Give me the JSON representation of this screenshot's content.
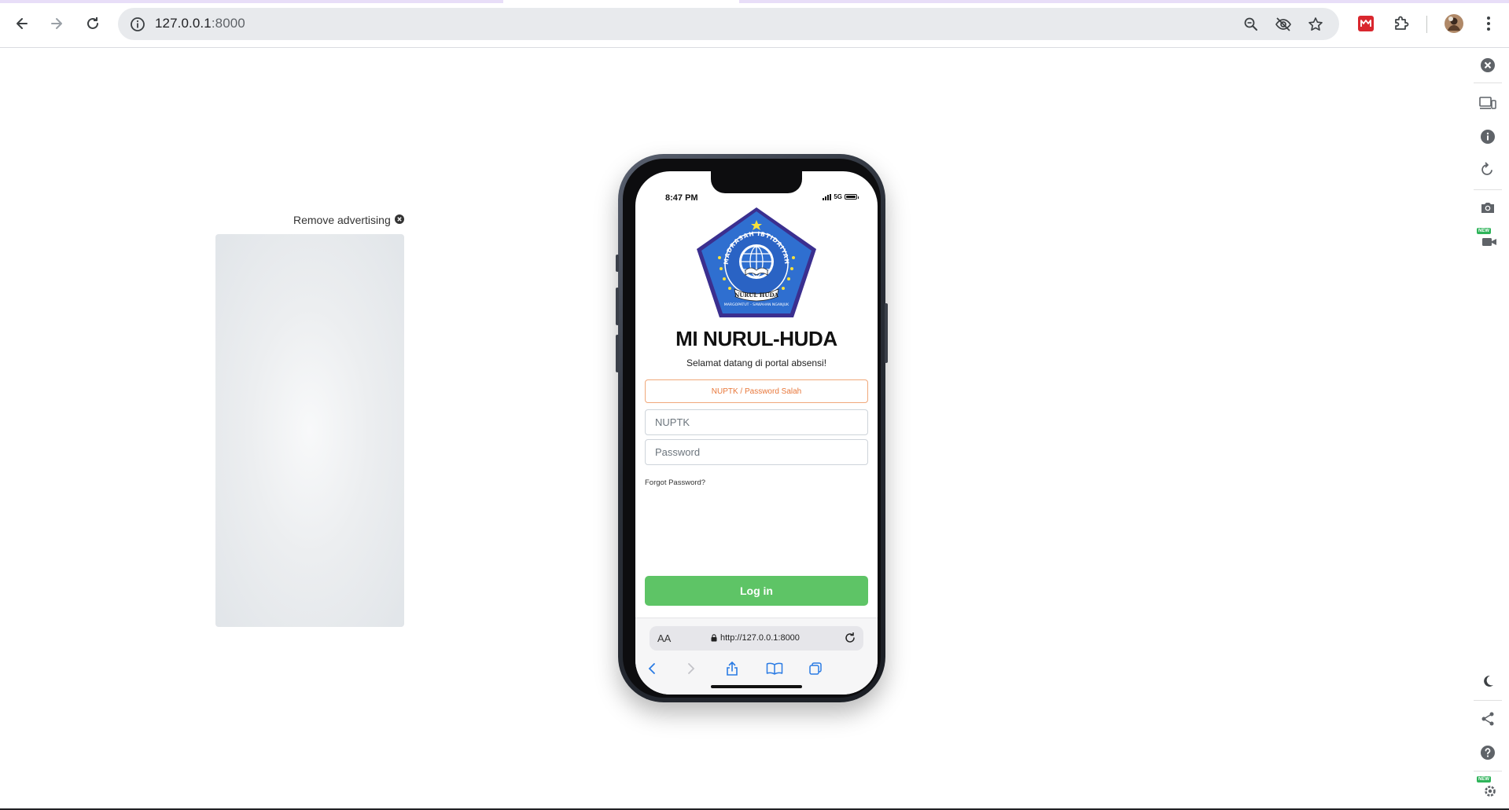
{
  "browser": {
    "url_host": "127.0.0.1",
    "url_port": ":8000",
    "icons": [
      "back-arrow-icon",
      "forward-arrow-icon",
      "reload-icon",
      "site-info-icon",
      "zoom-icon",
      "eye-off-icon",
      "star-icon",
      "extension-red-icon",
      "puzzle-icon",
      "profile-avatar",
      "kebab-menu-icon"
    ]
  },
  "ad": {
    "remove_label": "Remove advertising"
  },
  "phone": {
    "status_time": "8:47 PM",
    "network": "5G",
    "school_name": "MI NURUL-HUDA",
    "welcome": "Selamat datang di portal absensi!",
    "error_message": "NUPTK / Password Salah",
    "nuptk_placeholder": "NUPTK",
    "password_placeholder": "Password",
    "forgot_password": "Forgot Password?",
    "login_label": "Log in",
    "safari_aa": "AA",
    "safari_url": "http://127.0.0.1:8000",
    "logo_text_top": "MADRASAH IBTIDAIYAH",
    "logo_ribbon": "NURUL HUDA",
    "logo_text_bottom": "MARGOPATUT - SAWAHAN NGANJUK"
  },
  "sidebar_panel": {
    "icons": [
      "close-icon",
      "devices-icon",
      "info-icon",
      "rotate-icon",
      "camera-icon",
      "video-new-icon",
      "dark-mode-icon",
      "share-icon",
      "help-icon",
      "settings-new-icon"
    ],
    "new_badge": "NEW"
  },
  "colors": {
    "login_green": "#5ec466",
    "error_orange": "#e8773a",
    "logo_blue": "#2f6fd0",
    "logo_border": "#3b2f8f"
  }
}
